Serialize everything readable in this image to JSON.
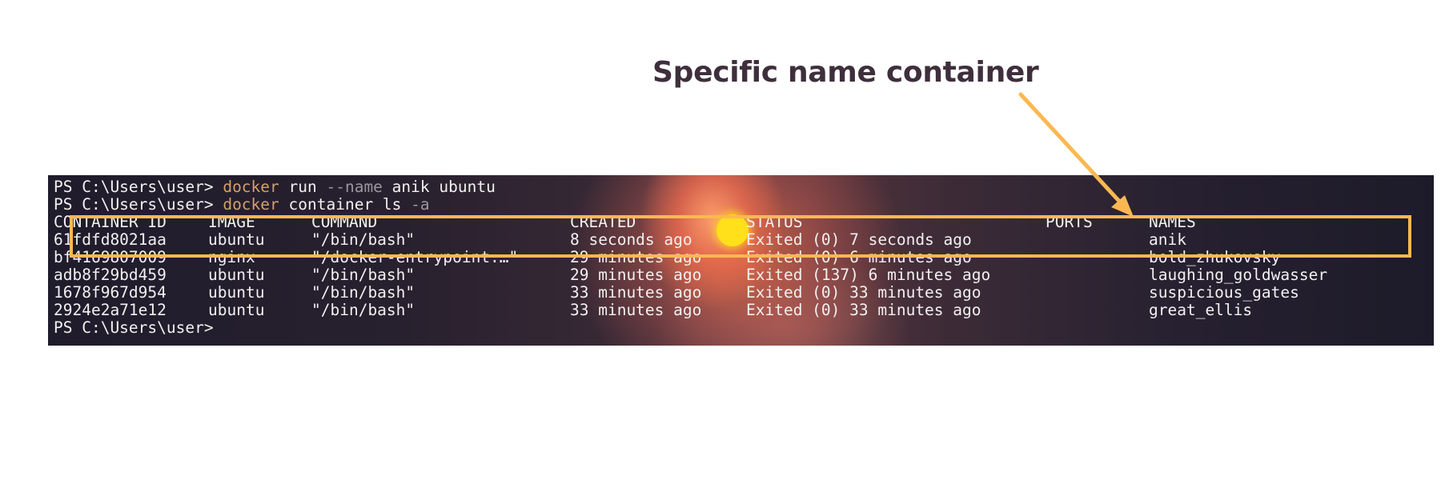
{
  "annotation": {
    "title": "Specific name container",
    "accent_color": "#fbb852"
  },
  "terminal": {
    "prompt_lines": [
      {
        "prompt": "PS C:\\Users\\user> ",
        "command": "docker",
        "args": " run ",
        "flag": "--name",
        "rest": " anik ubuntu"
      },
      {
        "prompt": "PS C:\\Users\\user> ",
        "command": "docker",
        "args": " container ls ",
        "flag": "-a",
        "rest": ""
      }
    ],
    "table": {
      "headers": [
        "CONTAINER ID",
        "IMAGE",
        "COMMAND",
        "CREATED",
        "STATUS",
        "PORTS",
        "NAMES"
      ],
      "rows": [
        [
          "61fdfd8021aa",
          "ubuntu",
          "\"/bin/bash\"",
          "8 seconds ago",
          "Exited (0) 7 seconds ago",
          "",
          "anik"
        ],
        [
          "bf4169807009",
          "nginx",
          "\"/docker-entrypoint.…\"",
          "29 minutes ago",
          "Exited (0) 6 minutes ago",
          "",
          "bold_zhukovsky"
        ],
        [
          "adb8f29bd459",
          "ubuntu",
          "\"/bin/bash\"",
          "29 minutes ago",
          "Exited (137) 6 minutes ago",
          "",
          "laughing_goldwasser"
        ],
        [
          "1678f967d954",
          "ubuntu",
          "\"/bin/bash\"",
          "33 minutes ago",
          "Exited (0) 33 minutes ago",
          "",
          "suspicious_gates"
        ],
        [
          "2924e2a71e12",
          "ubuntu",
          "\"/bin/bash\"",
          "33 minutes ago",
          "Exited (0) 33 minutes ago",
          "",
          "great_ellis"
        ]
      ]
    },
    "final_prompt": "PS C:\\Users\\user>"
  }
}
